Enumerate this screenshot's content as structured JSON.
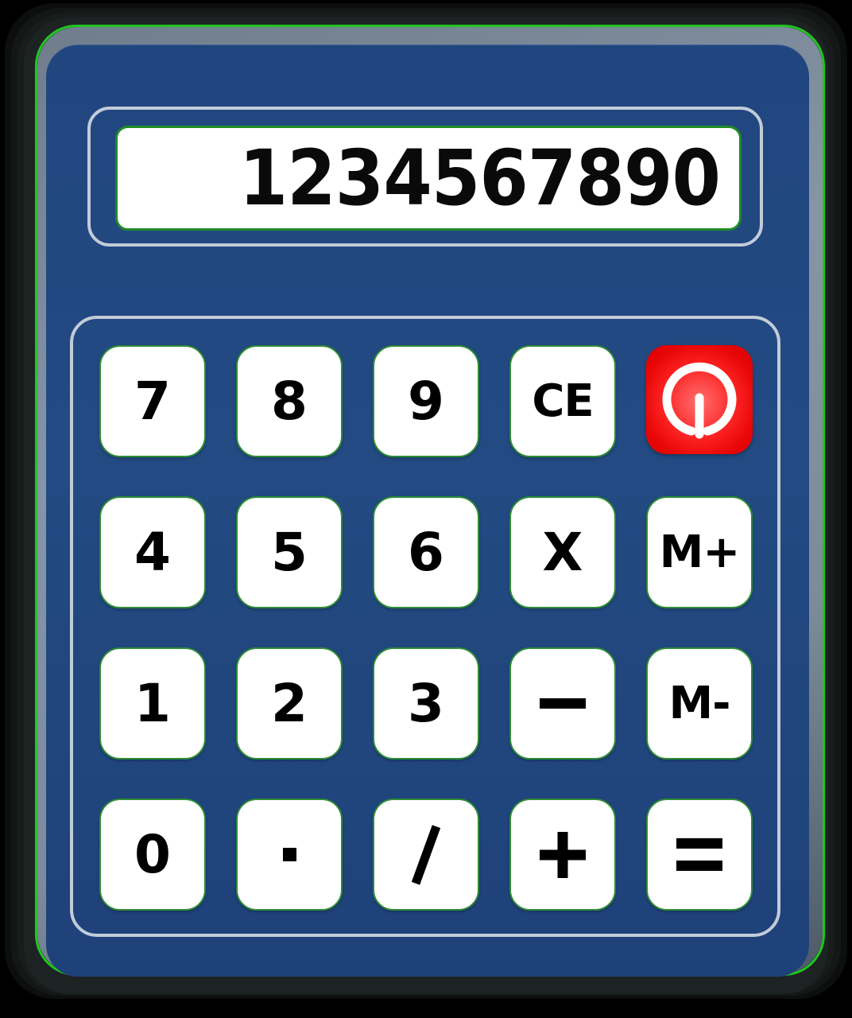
{
  "device": {
    "name": "Pocket Calculator",
    "colors": {
      "shell": "#14191 8",
      "shell_black": "#131716",
      "accent_green": "#21c521",
      "bezel_gray": "#8695a6",
      "body_navy": "#234a82",
      "frame_light": "#c2ccd9",
      "key_face": "#ffffff",
      "key_outline": "#2d8c35",
      "key_text": "#000000",
      "screen_white": "#ffffff",
      "screen_border_green": "#1d8c26",
      "power_red": "#fb2222"
    }
  },
  "display": {
    "value": "1234567890",
    "align": "right"
  },
  "keypad": {
    "rows": [
      [
        {
          "label": "7",
          "name": "key-7",
          "kind": "digit"
        },
        {
          "label": "8",
          "name": "key-8",
          "kind": "digit"
        },
        {
          "label": "9",
          "name": "key-9",
          "kind": "digit"
        },
        {
          "label": "CE",
          "name": "key-clear-entry",
          "kind": "function"
        },
        {
          "label": "",
          "name": "key-power",
          "kind": "power",
          "icon": "power-icon"
        }
      ],
      [
        {
          "label": "4",
          "name": "key-4",
          "kind": "digit"
        },
        {
          "label": "5",
          "name": "key-5",
          "kind": "digit"
        },
        {
          "label": "6",
          "name": "key-6",
          "kind": "digit"
        },
        {
          "label": "X",
          "name": "key-multiply",
          "kind": "operator"
        },
        {
          "label": "M+",
          "name": "key-memory-add",
          "kind": "memory"
        }
      ],
      [
        {
          "label": "1",
          "name": "key-1",
          "kind": "digit"
        },
        {
          "label": "2",
          "name": "key-2",
          "kind": "digit"
        },
        {
          "label": "3",
          "name": "key-3",
          "kind": "digit"
        },
        {
          "label": "–",
          "name": "key-subtract",
          "kind": "operator"
        },
        {
          "label": "M-",
          "name": "key-memory-subtract",
          "kind": "memory"
        }
      ],
      [
        {
          "label": "0",
          "name": "key-0",
          "kind": "digit"
        },
        {
          "label": "·",
          "name": "key-decimal",
          "kind": "digit"
        },
        {
          "label": "/",
          "name": "key-divide",
          "kind": "operator"
        },
        {
          "label": "+",
          "name": "key-add",
          "kind": "operator"
        },
        {
          "label": "=",
          "name": "key-equals",
          "kind": "operator"
        }
      ]
    ]
  }
}
